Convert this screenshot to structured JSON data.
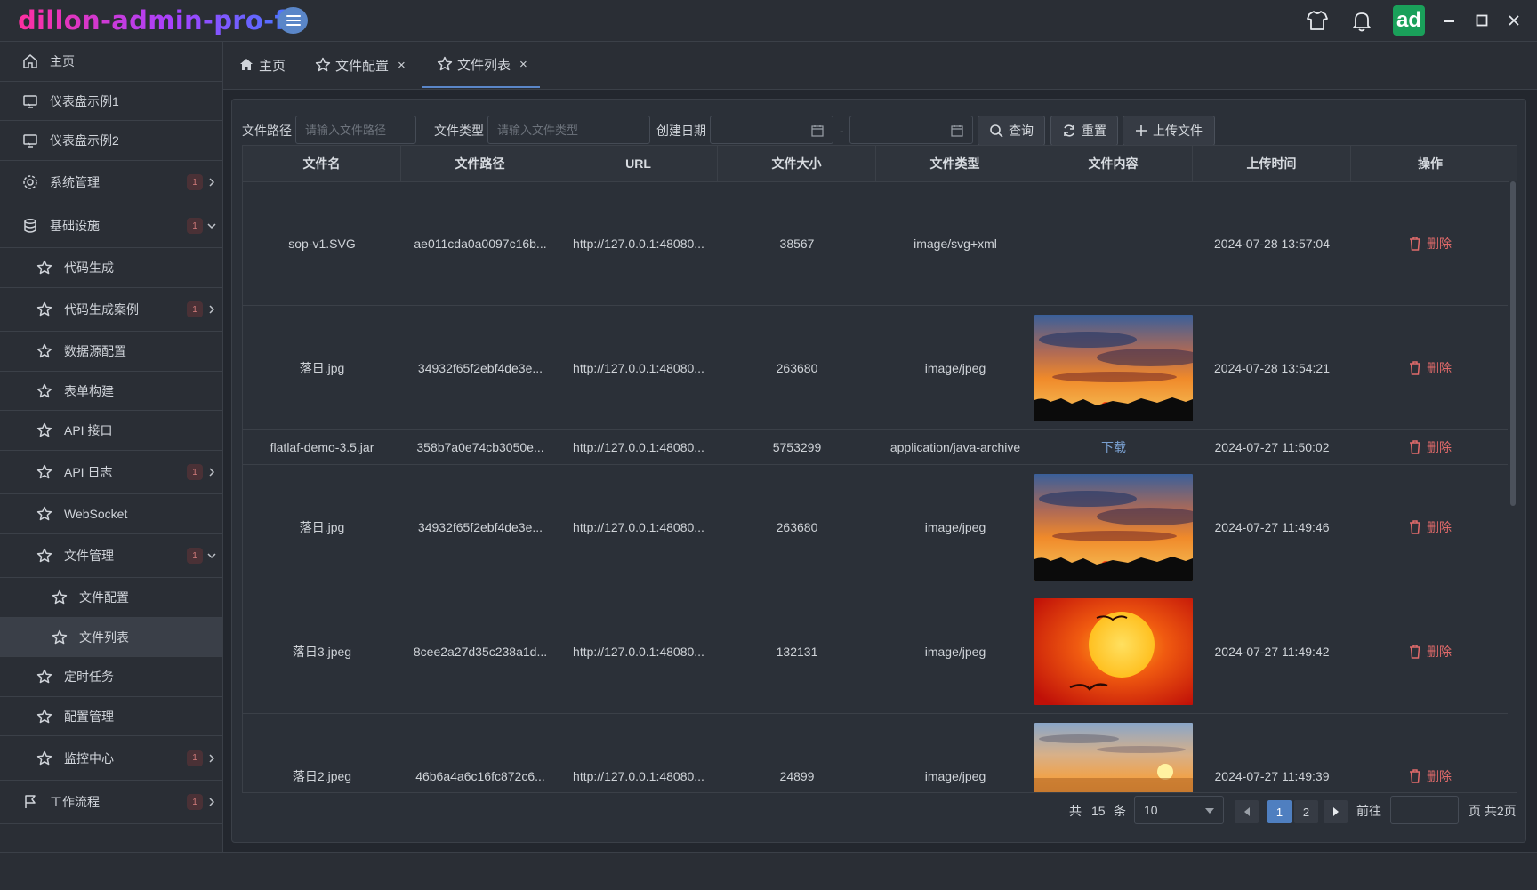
{
  "app": {
    "title": "dillon-admin-pro-fx",
    "avatar": "ad"
  },
  "sidebar": {
    "items": [
      {
        "label": "主页",
        "icon": "home-icon"
      },
      {
        "label": "仪表盘示例1",
        "icon": "monitor-icon"
      },
      {
        "label": "仪表盘示例2",
        "icon": "monitor-icon"
      },
      {
        "label": "系统管理",
        "icon": "gear-icon",
        "badge": "1"
      },
      {
        "label": "基础设施",
        "icon": "database-icon",
        "badge": "1"
      },
      {
        "label": "代码生成",
        "icon": "star-icon"
      },
      {
        "label": "代码生成案例",
        "icon": "star-icon",
        "badge": "1"
      },
      {
        "label": "数据源配置",
        "icon": "star-icon"
      },
      {
        "label": "表单构建",
        "icon": "star-icon"
      },
      {
        "label": "API 接口",
        "icon": "star-icon"
      },
      {
        "label": "API 日志",
        "icon": "star-icon",
        "badge": "1"
      },
      {
        "label": "WebSocket",
        "icon": "star-icon"
      },
      {
        "label": "文件管理",
        "icon": "star-icon",
        "badge": "1"
      },
      {
        "label": "文件配置",
        "icon": "star-icon"
      },
      {
        "label": "文件列表",
        "icon": "star-icon"
      },
      {
        "label": "定时任务",
        "icon": "star-icon"
      },
      {
        "label": "配置管理",
        "icon": "star-icon"
      },
      {
        "label": "监控中心",
        "icon": "star-icon",
        "badge": "1"
      },
      {
        "label": "工作流程",
        "icon": "flag-icon",
        "badge": "1"
      }
    ]
  },
  "tabs": [
    {
      "label": "主页",
      "icon": "home-icon"
    },
    {
      "label": "文件配置",
      "icon": "star-icon",
      "close": "×"
    },
    {
      "label": "文件列表",
      "icon": "star-icon",
      "close": "×"
    }
  ],
  "filters": {
    "path_label": "文件路径",
    "path_placeholder": "请输入文件路径",
    "type_label": "文件类型",
    "type_placeholder": "请输入文件类型",
    "date_label": "创建日期",
    "date_sep": "-",
    "query": "查询",
    "reset": "重置",
    "upload": "上传文件"
  },
  "table": {
    "headers": [
      "文件名",
      "文件路径",
      "URL",
      "文件大小",
      "文件类型",
      "文件内容",
      "上传时间",
      "操作"
    ],
    "delete_label": "删除",
    "download_label": "下载",
    "rows": [
      {
        "name": "sop-v1.SVG",
        "path": "ae011cda0a0097c16b...",
        "url": "http://127.0.0.1:48080...",
        "size": "38567",
        "type": "image/svg+xml",
        "content": "none",
        "time": "2024-07-28 13:57:04"
      },
      {
        "name": "落日.jpg",
        "path": "34932f65f2ebf4de3e...",
        "url": "http://127.0.0.1:48080...",
        "size": "263680",
        "type": "image/jpeg",
        "content": "sunset-image",
        "time": "2024-07-28 13:54:21"
      },
      {
        "name": "flatlaf-demo-3.5.jar",
        "path": "358b7a0e74cb3050e...",
        "url": "http://127.0.0.1:48080...",
        "size": "5753299",
        "type": "application/java-archive",
        "content": "download",
        "time": "2024-07-27 11:50:02"
      },
      {
        "name": "落日.jpg",
        "path": "34932f65f2ebf4de3e...",
        "url": "http://127.0.0.1:48080...",
        "size": "263680",
        "type": "image/jpeg",
        "content": "sunset-image",
        "time": "2024-07-27 11:49:46"
      },
      {
        "name": "落日3.jpeg",
        "path": "8cee2a27d35c238a1d...",
        "url": "http://127.0.0.1:48080...",
        "size": "132131",
        "type": "image/jpeg",
        "content": "red-sun-image",
        "time": "2024-07-27 11:49:42"
      },
      {
        "name": "落日2.jpeg",
        "path": "46b6a4a6c16fc872c6...",
        "url": "http://127.0.0.1:48080...",
        "size": "24899",
        "type": "image/jpeg",
        "content": "ocean-sunset-image",
        "time": "2024-07-27 11:49:39"
      }
    ]
  },
  "pagination": {
    "total_prefix": "共",
    "total": "15",
    "total_suffix": "条",
    "page_size": "10",
    "pages": [
      "1",
      "2"
    ],
    "current": "1",
    "goto_label": "前往",
    "page_suffix": "页 共2页"
  },
  "colors": {
    "accent": "#5a86c8",
    "danger": "#e06a6a",
    "avatar_bg": "#1aa05a"
  }
}
